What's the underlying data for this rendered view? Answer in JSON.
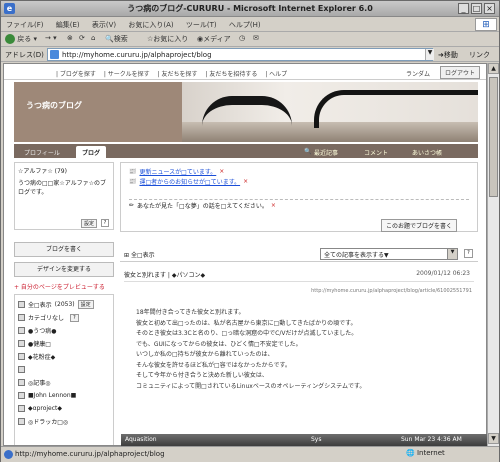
{
  "window": {
    "title": "うつ病のブログ-CURURU - Microsoft Internet Explorer 6.0",
    "menu": [
      "ファイル(F)",
      "編集(E)",
      "表示(V)",
      "お気に入り(A)",
      "ツール(T)",
      "ヘルプ(H)"
    ],
    "toolbar": {
      "back": "戻る",
      "search": "検索",
      "favorites": "お気に入り",
      "media": "メディア"
    },
    "address_label": "アドレス(D)",
    "link_label": "リンク",
    "url": "http://myhome.cururu.jp/alphaproject/blog",
    "go_label": "移動",
    "status_text": "http://myhome.cururu.jp/alphaproject/blog",
    "zone": "Internet",
    "taskbar": {
      "app": "Aquasition",
      "sys": "Sys",
      "clock": "Sun Mar 23  4:36 AM"
    }
  },
  "site": {
    "nav": [
      "| ブログを探す",
      "| サークルを探す",
      "| 友だちを探す",
      "| 友だちを招待する",
      "| ヘルプ"
    ],
    "random": "ランダム",
    "logout": "ログアウト",
    "blog_title": "うつ病のブログ",
    "tabs": [
      "プロフィール",
      "ブログ"
    ],
    "right_tabs": [
      "最近記事",
      "コメント",
      "あいさつ帳"
    ]
  },
  "left": {
    "profile_name": "☆アルファ☆ (79)",
    "profile_text": "うつ病の□□家☆アルファ☆のブログです。",
    "settings": "設定",
    "q": "?",
    "write_btn": "ブログを書く",
    "design_btn": "デザインを変更する",
    "preview": "+ 自分のページをプレビューする",
    "categories": [
      {
        "label": "全□表示",
        "count": "(2053)",
        "set": "設定"
      },
      {
        "label": "カテゴリなし",
        "count": "",
        "set": "?"
      },
      {
        "label": "●うつ病●",
        "count": "",
        "set": ""
      },
      {
        "label": "●健康□",
        "count": "",
        "set": ""
      },
      {
        "label": "◆花粉症◆",
        "count": "",
        "set": ""
      },
      {
        "label": "",
        "count": "",
        "set": ""
      },
      {
        "label": "◎記事◎",
        "count": "",
        "set": ""
      },
      {
        "label": "■John Lennon■",
        "count": "",
        "set": ""
      },
      {
        "label": "◆αproject◆",
        "count": "",
        "set": ""
      },
      {
        "label": "◎ドラッカ□◎",
        "count": "",
        "set": ""
      }
    ]
  },
  "main": {
    "notices": [
      {
        "text": "更新ニュースが□ています。",
        "x": "×"
      },
      {
        "text": "運□者からのお知らせが□ています。",
        "x": "×"
      },
      {
        "text": "あなたが見た「□な夢」の話を□えてください。",
        "x": "×"
      }
    ],
    "theme_btn": "このお題でブログを書く",
    "filter_label": "全□表示",
    "filter_select": "全ての記事を表示する▼",
    "q": "?",
    "article": {
      "title": "彼女と別れます | ◆パソコン◆",
      "date": "2009/01/12 06:23",
      "permalink": "http://myhome.cururu.jp/alphaproject/blog/article/61002551791",
      "lines": [
        "18年間付き合ってきた彼女と別れます。",
        "彼女と初めて出□ったのは、私が名古屋から東京に□動してきたばかりの頃です。",
        "そのとき彼女は3.3Cと名のり、□っ暗な洞窟の中でC/Vだけが点滅していました。",
        "でも、GUIになってからの彼女は、ひどく情□不安定でした。",
        "いつしか私の□持ちが彼女から離れていったのは、",
        "そんな彼女を許せるほど私が□容ではなかったからです。",
        "",
        "そして今年から付き合うと決めた新しい彼女は、",
        "コミュニティによって開□されているLinuxベースのオペレーティングシステムです。"
      ]
    }
  }
}
